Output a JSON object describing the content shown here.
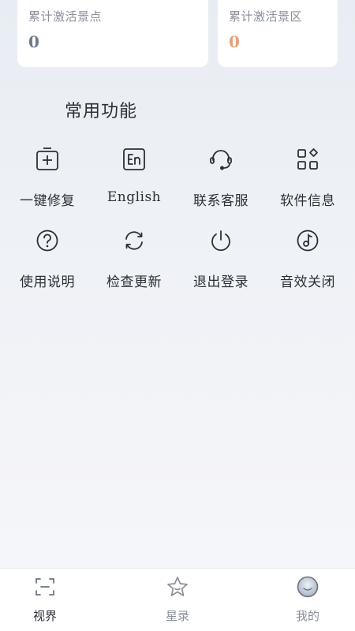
{
  "stats": {
    "activated_spots": {
      "label": "累计激活景点",
      "value": "0",
      "color": "#6e7a8a"
    },
    "activated_areas": {
      "label": "累计激活景区",
      "value": "0",
      "color": "#e8a07a"
    }
  },
  "section": {
    "title": "常用功能"
  },
  "functions": [
    {
      "label": "一键修复",
      "icon": "repair-icon"
    },
    {
      "label": "English",
      "icon": "english-icon"
    },
    {
      "label": "联系客服",
      "icon": "headset-icon"
    },
    {
      "label": "软件信息",
      "icon": "apps-icon"
    },
    {
      "label": "使用说明",
      "icon": "help-icon"
    },
    {
      "label": "检查更新",
      "icon": "refresh-icon"
    },
    {
      "label": "退出登录",
      "icon": "power-icon"
    },
    {
      "label": "音效关闭",
      "icon": "music-icon"
    }
  ],
  "tabbar": {
    "tabs": [
      {
        "label": "视界",
        "icon": "scan-icon",
        "active": true
      },
      {
        "label": "星录",
        "icon": "star-icon",
        "active": false
      },
      {
        "label": "我的",
        "icon": "avatar-icon",
        "active": false
      }
    ],
    "active_color": "#2b2f36",
    "inactive_color": "#8a8f99"
  }
}
